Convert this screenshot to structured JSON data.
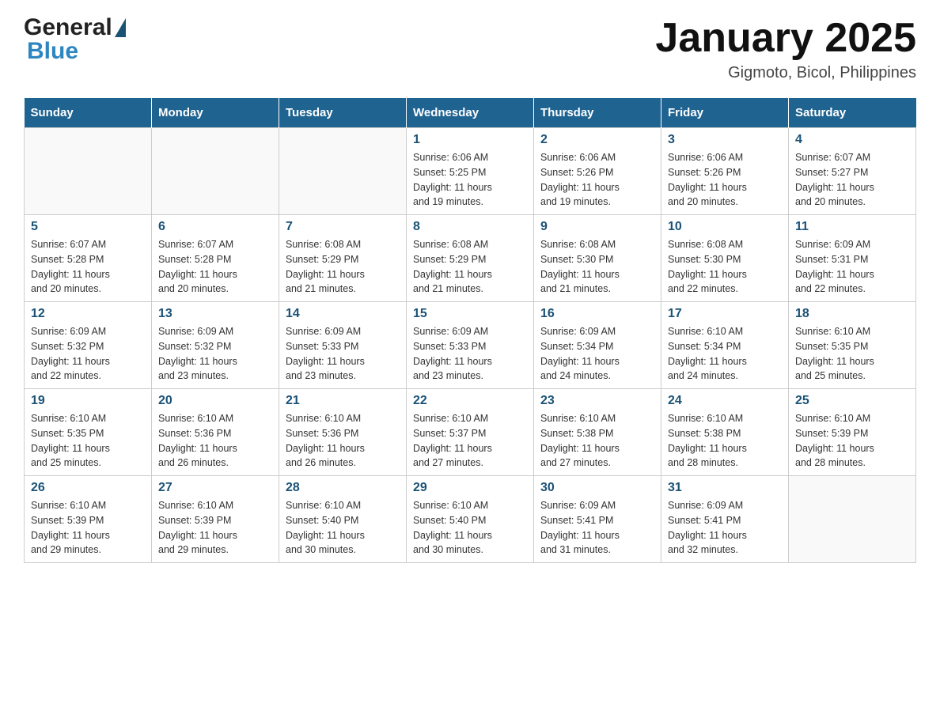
{
  "header": {
    "logo_general": "General",
    "logo_blue": "Blue",
    "title": "January 2025",
    "subtitle": "Gigmoto, Bicol, Philippines"
  },
  "days_of_week": [
    "Sunday",
    "Monday",
    "Tuesday",
    "Wednesday",
    "Thursday",
    "Friday",
    "Saturday"
  ],
  "weeks": [
    [
      {
        "day": "",
        "info": ""
      },
      {
        "day": "",
        "info": ""
      },
      {
        "day": "",
        "info": ""
      },
      {
        "day": "1",
        "info": "Sunrise: 6:06 AM\nSunset: 5:25 PM\nDaylight: 11 hours\nand 19 minutes."
      },
      {
        "day": "2",
        "info": "Sunrise: 6:06 AM\nSunset: 5:26 PM\nDaylight: 11 hours\nand 19 minutes."
      },
      {
        "day": "3",
        "info": "Sunrise: 6:06 AM\nSunset: 5:26 PM\nDaylight: 11 hours\nand 20 minutes."
      },
      {
        "day": "4",
        "info": "Sunrise: 6:07 AM\nSunset: 5:27 PM\nDaylight: 11 hours\nand 20 minutes."
      }
    ],
    [
      {
        "day": "5",
        "info": "Sunrise: 6:07 AM\nSunset: 5:28 PM\nDaylight: 11 hours\nand 20 minutes."
      },
      {
        "day": "6",
        "info": "Sunrise: 6:07 AM\nSunset: 5:28 PM\nDaylight: 11 hours\nand 20 minutes."
      },
      {
        "day": "7",
        "info": "Sunrise: 6:08 AM\nSunset: 5:29 PM\nDaylight: 11 hours\nand 21 minutes."
      },
      {
        "day": "8",
        "info": "Sunrise: 6:08 AM\nSunset: 5:29 PM\nDaylight: 11 hours\nand 21 minutes."
      },
      {
        "day": "9",
        "info": "Sunrise: 6:08 AM\nSunset: 5:30 PM\nDaylight: 11 hours\nand 21 minutes."
      },
      {
        "day": "10",
        "info": "Sunrise: 6:08 AM\nSunset: 5:30 PM\nDaylight: 11 hours\nand 22 minutes."
      },
      {
        "day": "11",
        "info": "Sunrise: 6:09 AM\nSunset: 5:31 PM\nDaylight: 11 hours\nand 22 minutes."
      }
    ],
    [
      {
        "day": "12",
        "info": "Sunrise: 6:09 AM\nSunset: 5:32 PM\nDaylight: 11 hours\nand 22 minutes."
      },
      {
        "day": "13",
        "info": "Sunrise: 6:09 AM\nSunset: 5:32 PM\nDaylight: 11 hours\nand 23 minutes."
      },
      {
        "day": "14",
        "info": "Sunrise: 6:09 AM\nSunset: 5:33 PM\nDaylight: 11 hours\nand 23 minutes."
      },
      {
        "day": "15",
        "info": "Sunrise: 6:09 AM\nSunset: 5:33 PM\nDaylight: 11 hours\nand 23 minutes."
      },
      {
        "day": "16",
        "info": "Sunrise: 6:09 AM\nSunset: 5:34 PM\nDaylight: 11 hours\nand 24 minutes."
      },
      {
        "day": "17",
        "info": "Sunrise: 6:10 AM\nSunset: 5:34 PM\nDaylight: 11 hours\nand 24 minutes."
      },
      {
        "day": "18",
        "info": "Sunrise: 6:10 AM\nSunset: 5:35 PM\nDaylight: 11 hours\nand 25 minutes."
      }
    ],
    [
      {
        "day": "19",
        "info": "Sunrise: 6:10 AM\nSunset: 5:35 PM\nDaylight: 11 hours\nand 25 minutes."
      },
      {
        "day": "20",
        "info": "Sunrise: 6:10 AM\nSunset: 5:36 PM\nDaylight: 11 hours\nand 26 minutes."
      },
      {
        "day": "21",
        "info": "Sunrise: 6:10 AM\nSunset: 5:36 PM\nDaylight: 11 hours\nand 26 minutes."
      },
      {
        "day": "22",
        "info": "Sunrise: 6:10 AM\nSunset: 5:37 PM\nDaylight: 11 hours\nand 27 minutes."
      },
      {
        "day": "23",
        "info": "Sunrise: 6:10 AM\nSunset: 5:38 PM\nDaylight: 11 hours\nand 27 minutes."
      },
      {
        "day": "24",
        "info": "Sunrise: 6:10 AM\nSunset: 5:38 PM\nDaylight: 11 hours\nand 28 minutes."
      },
      {
        "day": "25",
        "info": "Sunrise: 6:10 AM\nSunset: 5:39 PM\nDaylight: 11 hours\nand 28 minutes."
      }
    ],
    [
      {
        "day": "26",
        "info": "Sunrise: 6:10 AM\nSunset: 5:39 PM\nDaylight: 11 hours\nand 29 minutes."
      },
      {
        "day": "27",
        "info": "Sunrise: 6:10 AM\nSunset: 5:39 PM\nDaylight: 11 hours\nand 29 minutes."
      },
      {
        "day": "28",
        "info": "Sunrise: 6:10 AM\nSunset: 5:40 PM\nDaylight: 11 hours\nand 30 minutes."
      },
      {
        "day": "29",
        "info": "Sunrise: 6:10 AM\nSunset: 5:40 PM\nDaylight: 11 hours\nand 30 minutes."
      },
      {
        "day": "30",
        "info": "Sunrise: 6:09 AM\nSunset: 5:41 PM\nDaylight: 11 hours\nand 31 minutes."
      },
      {
        "day": "31",
        "info": "Sunrise: 6:09 AM\nSunset: 5:41 PM\nDaylight: 11 hours\nand 32 minutes."
      },
      {
        "day": "",
        "info": ""
      }
    ]
  ]
}
